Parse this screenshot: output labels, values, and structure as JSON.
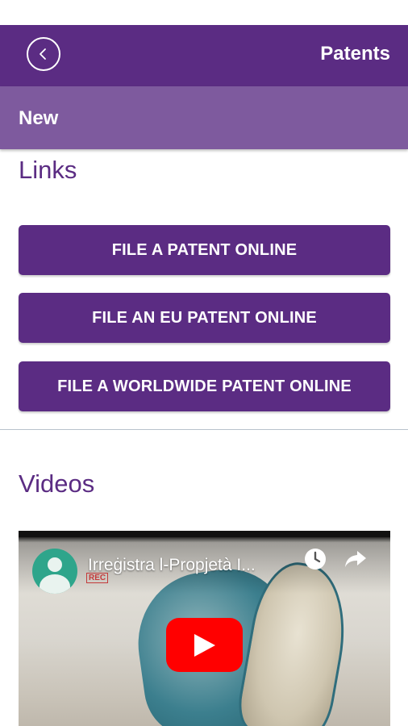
{
  "header": {
    "title": "Patents",
    "back_icon": "chevron-left-icon",
    "background": "#5b2c83"
  },
  "subheader": {
    "label": "New",
    "background": "#7e5a9e"
  },
  "links": {
    "heading": "Links",
    "buttons": [
      {
        "label": "FILE A PATENT ONLINE"
      },
      {
        "label": "FILE AN EU PATENT ONLINE"
      },
      {
        "label": "FILE A WORLDWIDE PATENT ONLINE"
      }
    ]
  },
  "videos": {
    "heading": "Videos",
    "items": [
      {
        "title": "Irreġistra l-Propjetà I...",
        "badge": "REC",
        "icons": [
          "channel-avatar-icon",
          "watch-later-icon",
          "share-icon",
          "play-icon"
        ]
      }
    ]
  },
  "colors": {
    "accent": "#5b2c83",
    "play_button": "#ff0000"
  }
}
